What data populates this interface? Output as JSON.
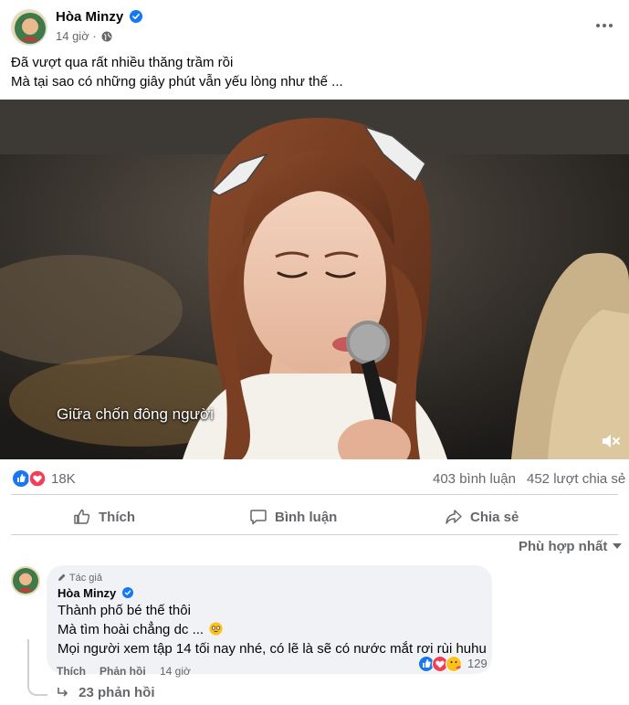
{
  "post": {
    "author": "Hòa Minzy",
    "time": "14 giờ",
    "text_line1": "Đã vượt qua rất nhiều thăng trầm rồi",
    "text_line2": "Mà tại sao có những giây phút vẫn yếu lòng như thế ..."
  },
  "video": {
    "subtitle": "Giữa chốn đông người"
  },
  "stats": {
    "reactions": "18K",
    "comments": "403 bình luận",
    "shares": "452 lượt chia sẻ"
  },
  "actions": {
    "like": "Thích",
    "comment": "Bình luận",
    "share": "Chia sẻ"
  },
  "sort": {
    "label": "Phù hợp nhất"
  },
  "comment": {
    "badge": "Tác giả",
    "author": "Hòa Minzy",
    "line1": "Thành phố bé thế thôi",
    "line2": "Mà tìm hoài chẳng dc ...",
    "line3": "Mọi người xem tập 14 tối nay nhé, có lẽ là sẽ có nước mắt rơi rùi huhu",
    "reaction_count": "129",
    "like": "Thích",
    "reply": "Phản hồi",
    "time": "14 giờ",
    "replies": "23 phản hồi"
  },
  "colors": {
    "facebook_blue": "#1877f2",
    "love_red": "#f33e58",
    "secondary_text": "#65676b",
    "bubble_bg": "#f0f2f5"
  },
  "icons": [
    "verified-icon",
    "globe-icon",
    "more-icon",
    "like-icon",
    "love-icon",
    "care-icon",
    "comment-icon",
    "share-icon",
    "mute-icon",
    "reply-arrow-icon",
    "edit-icon"
  ]
}
